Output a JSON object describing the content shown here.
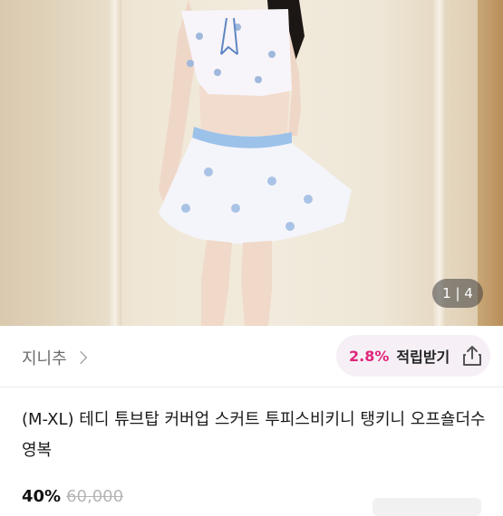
{
  "photo": {
    "alt_subject": "model wearing floral bandeau top with blue drawstring skirt",
    "counter": "1 | 4"
  },
  "shop": {
    "name": "지니추",
    "points_percent": "2.8%",
    "points_label": "적립받기"
  },
  "product": {
    "title": "(M-XL) 테디 튜브탑 커버업 스커트 투피스비키니 탱키니 오프숄더수영복",
    "discount": "40%",
    "original_price": "60,000"
  },
  "colors": {
    "accent_pink": "#e0257a",
    "badge_bg": "#f6f0f6",
    "ribbon_blue": "#9cc2ea"
  }
}
